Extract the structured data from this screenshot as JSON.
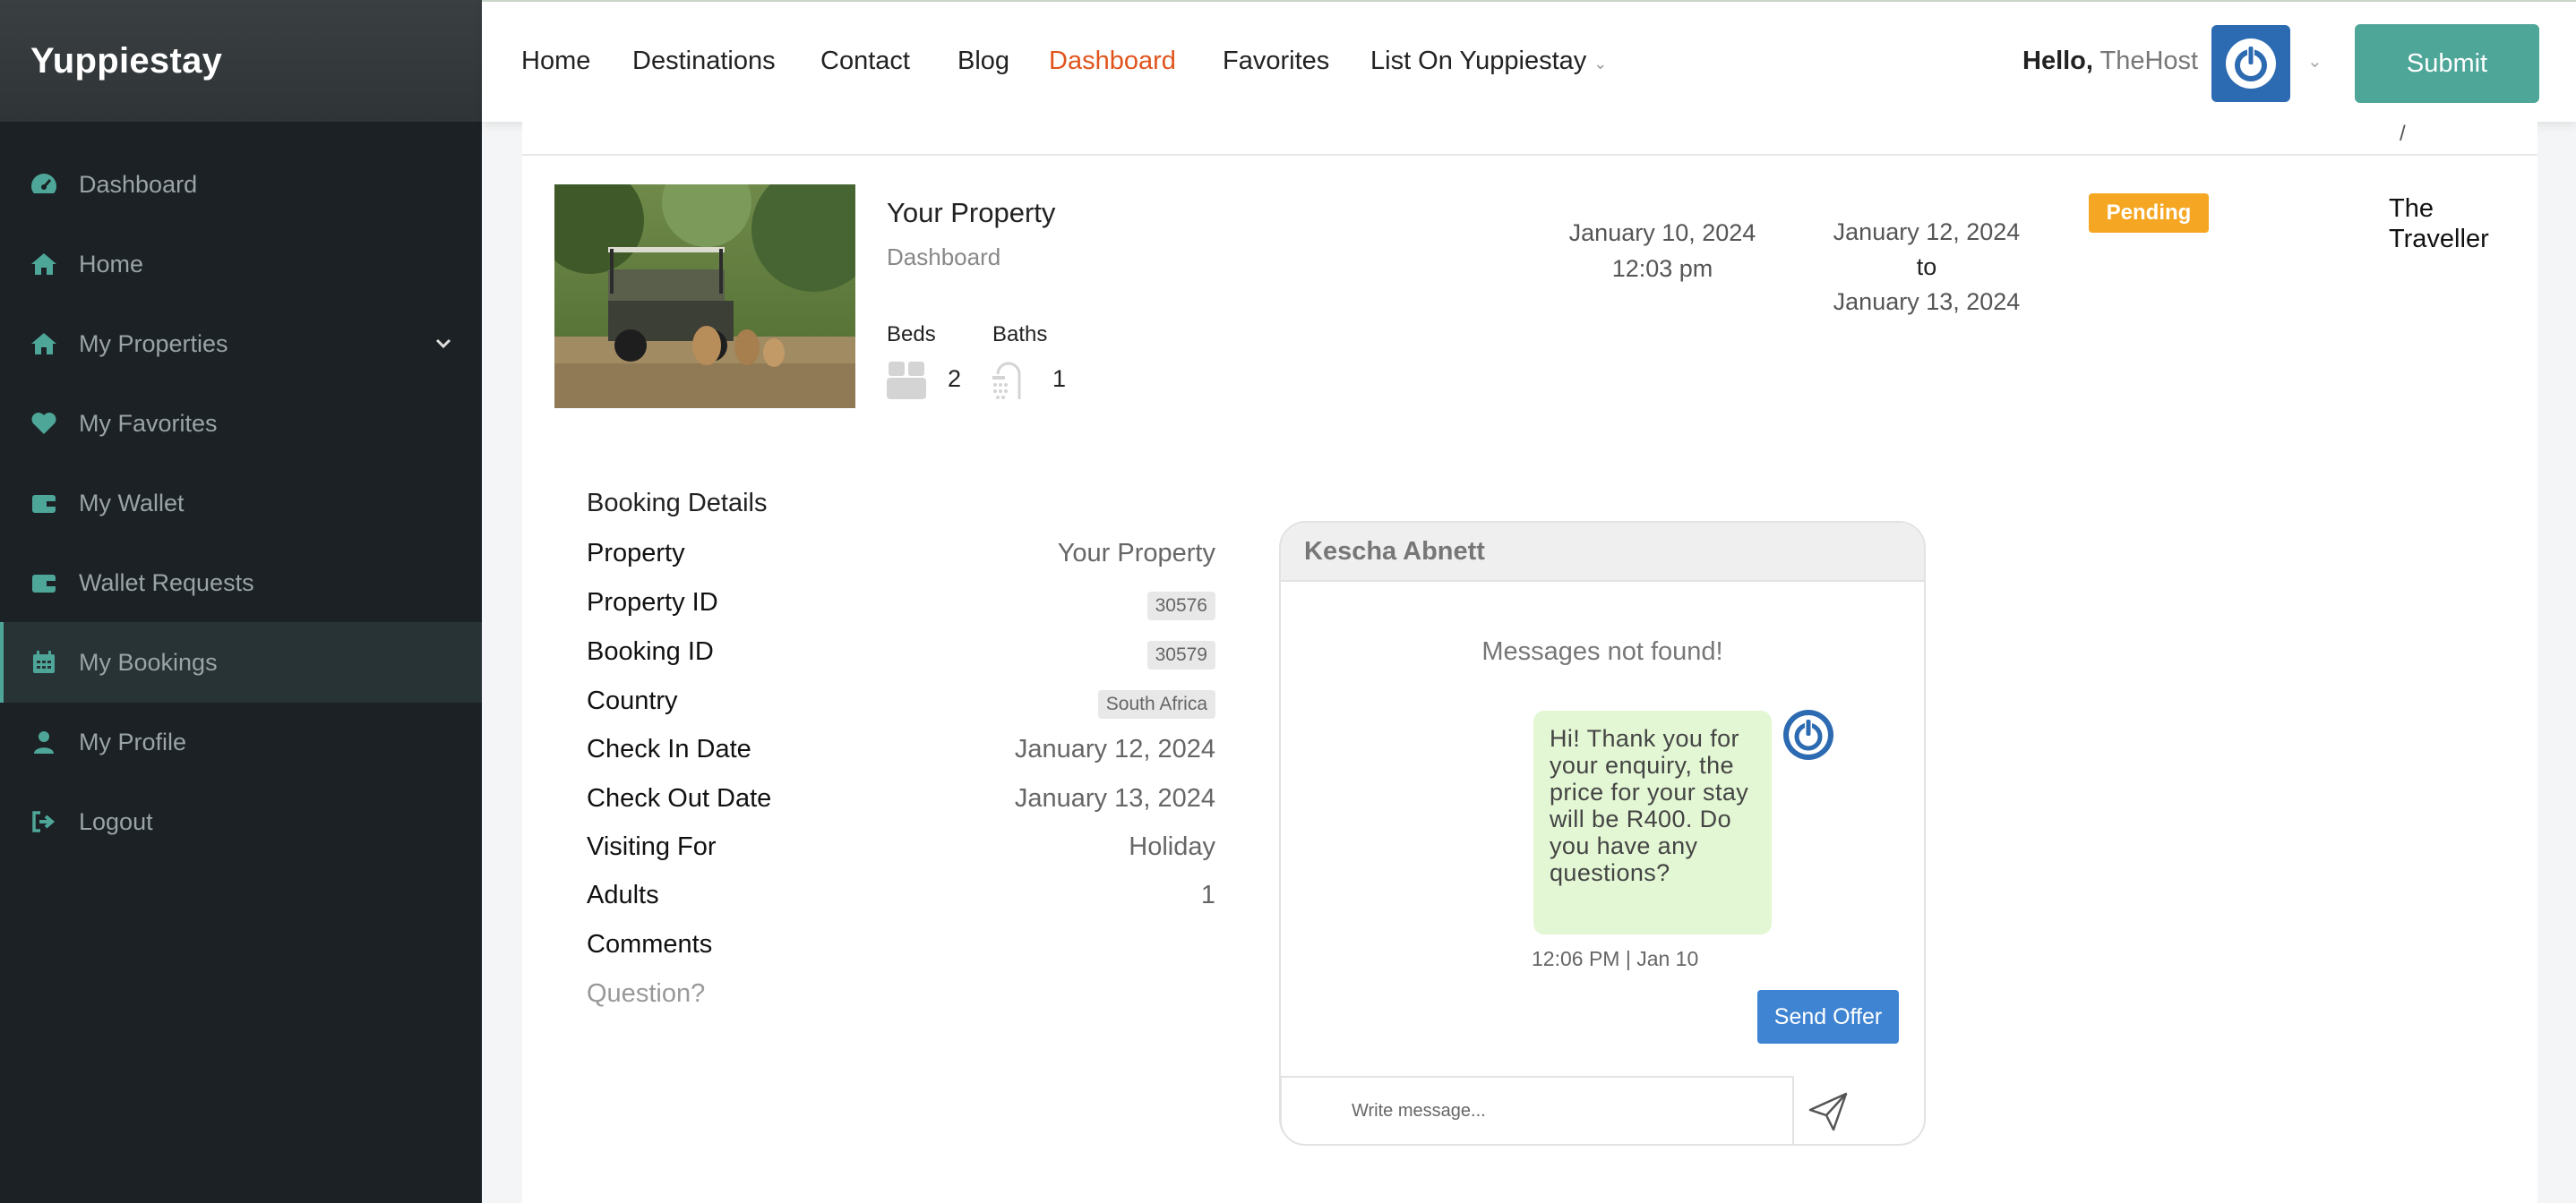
{
  "brand": "Yuppiestay",
  "sidebar": {
    "items": [
      {
        "label": "Dashboard",
        "icon": "dashboard-gauge-icon"
      },
      {
        "label": "Home",
        "icon": "home-icon"
      },
      {
        "label": "My Properties",
        "icon": "home-icon",
        "has_submenu": true
      },
      {
        "label": "My Favorites",
        "icon": "heart-icon"
      },
      {
        "label": "My Wallet",
        "icon": "wallet-icon"
      },
      {
        "label": "Wallet Requests",
        "icon": "wallet-icon"
      },
      {
        "label": "My Bookings",
        "icon": "calendar-icon",
        "active": true
      },
      {
        "label": "My Profile",
        "icon": "user-icon"
      },
      {
        "label": "Logout",
        "icon": "sign-out-icon"
      }
    ]
  },
  "topnav": {
    "links": [
      "Home",
      "Destinations",
      "Contact",
      "Blog",
      "Dashboard",
      "Favorites",
      "List On Yuppiestay"
    ],
    "active": "Dashboard",
    "hello": "Hello,",
    "username": "TheHost",
    "submit_label": "Submit"
  },
  "booking": {
    "title": "Your Property",
    "subtitle": "Dashboard",
    "beds_label": "Beds",
    "beds": "2",
    "baths_label": "Baths",
    "baths": "1",
    "created_date": "January 10, 2024",
    "created_time": "12:03 pm",
    "check_in": "January 12, 2024",
    "to": "to",
    "check_out": "January 13, 2024",
    "status": "Pending",
    "status_color": "#f5a623",
    "guest_line1": "The",
    "guest_line2": "Traveller"
  },
  "details": {
    "title": "Booking Details",
    "rows": [
      {
        "key": "Property",
        "value": "Your Property"
      },
      {
        "key": "Property ID",
        "value": "30576"
      },
      {
        "key": "Booking ID",
        "value": "30579"
      },
      {
        "key": "Country",
        "value": "South Africa"
      },
      {
        "key": "Check In Date",
        "value": "January 12, 2024"
      },
      {
        "key": "Check Out Date",
        "value": "January 13, 2024"
      },
      {
        "key": "Visiting For",
        "value": "Holiday"
      },
      {
        "key": "Adults",
        "value": "1"
      },
      {
        "key": "Comments",
        "value": ""
      }
    ],
    "comment_text": "Question?"
  },
  "chat": {
    "contact": "Kescha Abnett",
    "empty_text": "Messages not found!",
    "message": "Hi! Thank you for your enquiry, the price for your stay will be R400. Do you have any questions?",
    "message_time": "12:06 PM | Jan 10",
    "send_offer_label": "Send Offer",
    "input_placeholder": "Write message..."
  },
  "colors": {
    "accent": "#4ea699",
    "active_nav": "#e0541c",
    "sidebar_bg": "#1b2124",
    "avatar_blue": "#2c6ab1",
    "bubble_bg": "#e3f7d4",
    "send_offer": "#3f84d2"
  }
}
